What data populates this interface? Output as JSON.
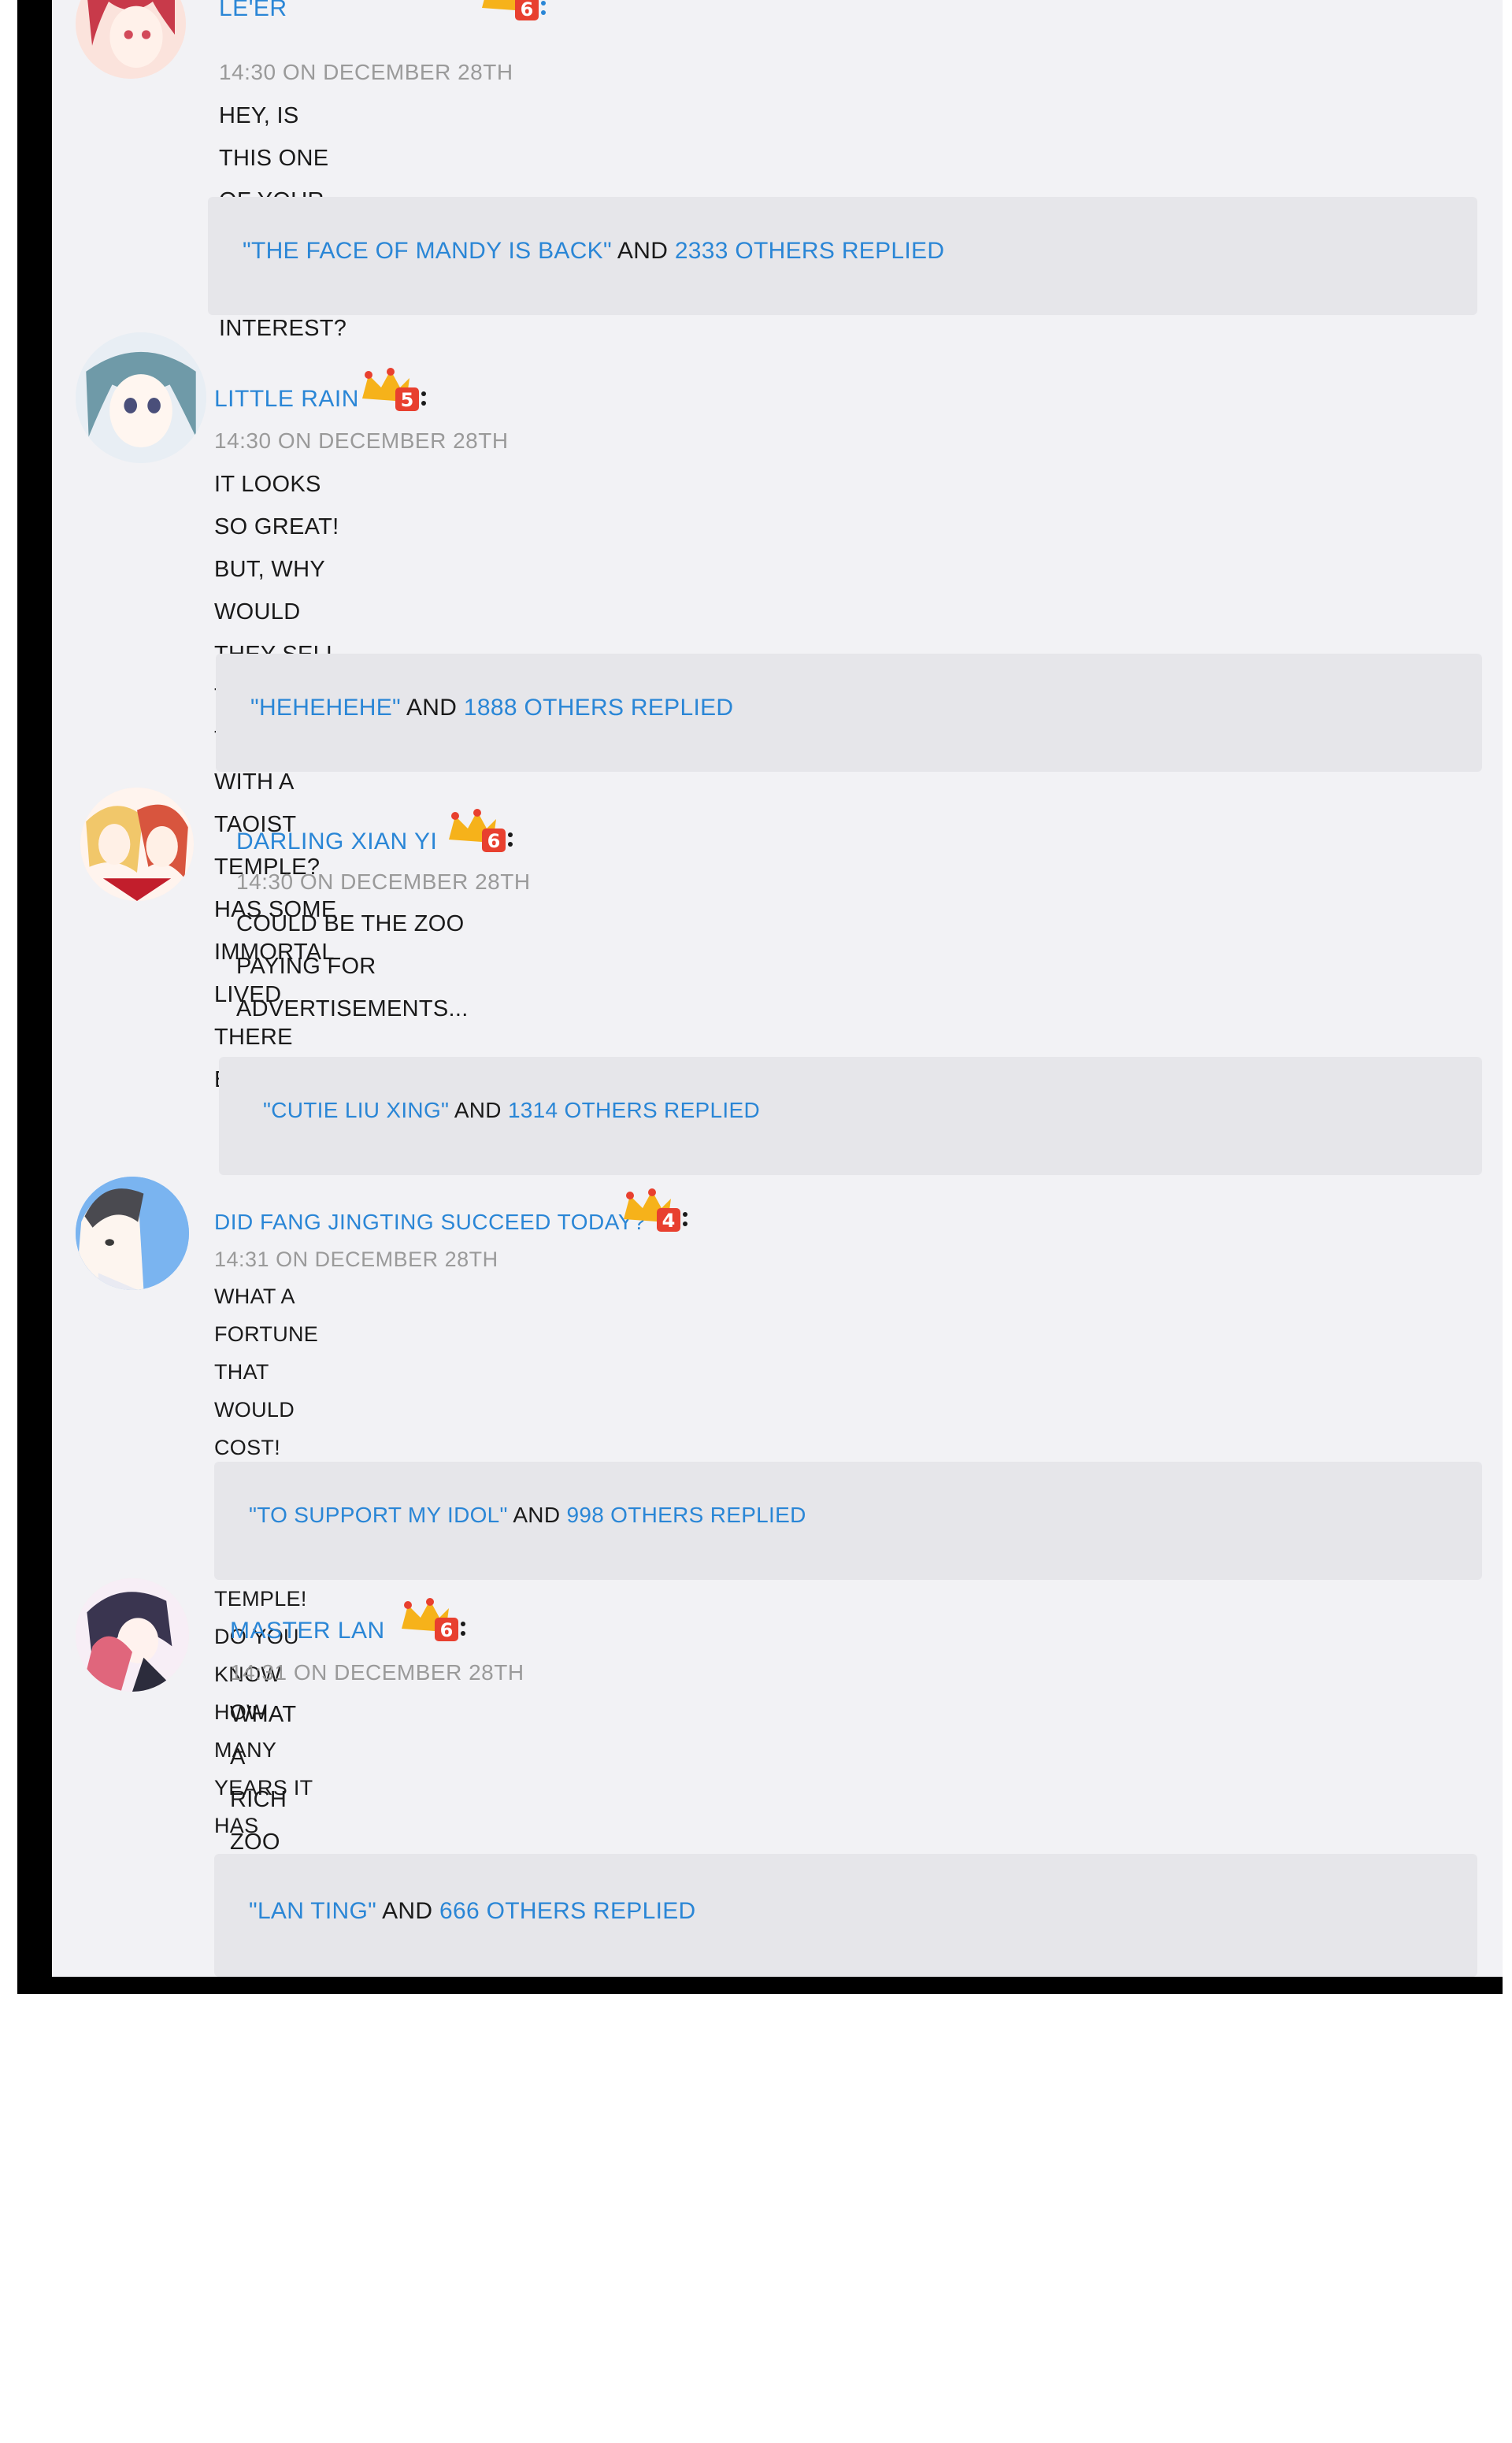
{
  "posts": [
    {
      "username": "LE'ER",
      "timestamp": "14:30 ON DECEMBER 28TH",
      "lines": [
        "HEY, IS THIS ONE OF YOUR PLACES OF INTEREST?"
      ],
      "level": "6",
      "reply": {
        "quote": "\"THE FACE OF MANDY IS BACK\"",
        "and": "AND",
        "count": "2333 OTHERS REPLIED"
      }
    },
    {
      "username": "LITTLE RAIN",
      "timestamp": "14:30 ON DECEMBER 28TH",
      "lines": [
        "IT LOOKS SO GREAT! BUT, WHY WOULD THEY SELL TICKETS",
        "TOGETHER WITH A TAOIST TEMPLE? HAS SOME IMMORTAL LIVED",
        "THERE BEFORE?"
      ],
      "level": "5",
      "reply": {
        "quote": "\"HEHEHEHE\"",
        "and": "AND",
        "count": "1888 OTHERS REPLIED"
      }
    },
    {
      "username": "DARLING XIAN YI",
      "timestamp": "14:30 ON DECEMBER 28TH",
      "lines": [
        "COULD BE THE ZOO PAYING FOR ADVERTISEMENTS..."
      ],
      "level": "6",
      "reply": {
        "quote": "\"CUTIE LIU XING\"",
        "and": "AND",
        "count": "1314 OTHERS REPLIED"
      }
    },
    {
      "username": "DID FANG JINGTING SUCCEED TODAY?",
      "timestamp": "14:31 ON DECEMBER 28TH",
      "lines": [
        "WHAT A FORTUNE THAT WOULD COST! AFTER ALL, IT IS LINSHUI TEMPLE! DO YOU",
        "KNOW HOW MANY YEARS IT HAS BEEN HERE?"
      ],
      "level": "4",
      "reply": {
        "quote": "\"TO SUPPORT MY IDOL\"",
        "and": "AND",
        "count": "998 OTHERS REPLIED"
      }
    },
    {
      "username": "MASTER LAN",
      "timestamp": "14:31 ON DECEMBER 28TH",
      "lines": [
        "WHAT A RICH ZOO THAT IS THEN."
      ],
      "level": "6",
      "reply": {
        "quote": "\"LAN TING\"",
        "and": "AND",
        "count": "666 OTHERS REPLIED"
      }
    }
  ],
  "colors": {
    "link": "#2a86d6",
    "text": "#1a1a1a",
    "timestamp": "#9a9a9a",
    "panel": "#f2f2f5",
    "reply_bg": "#e6e6ea",
    "frame": "#000000"
  },
  "icons": {
    "badge": "crown-level-badge-icon",
    "avatar": "user-avatar"
  }
}
